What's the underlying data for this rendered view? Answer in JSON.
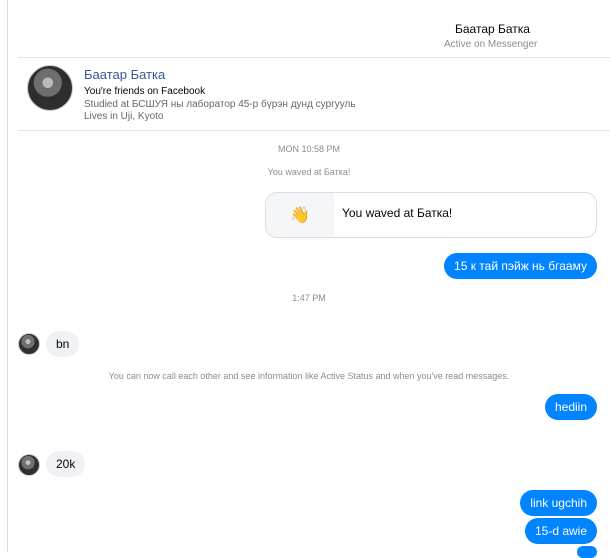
{
  "header": {
    "name": "Баатар Батка",
    "status": "Active on Messenger"
  },
  "profile": {
    "name": "Баатар Батка",
    "friends": "You're friends on Facebook",
    "studied": "Studied at БСШУЯ ны лаборатор 45-р бүрэн дунд сургууль",
    "lives": "Lives in Uji, Kyoto"
  },
  "messages": {
    "time_1": "MON 10:58 PM",
    "waved_note": "You waved at Батка!",
    "wave_card_text": "You waved at Батка!",
    "out_1": "15 к тай пэйж нь бгааму",
    "time_2": "1:47 PM",
    "in_1": "bn",
    "active_status_note": "You can now call each other and see information like Active Status and when you've read messages.",
    "out_2": "hediin",
    "in_2": "20k",
    "out_3": "link ugchih",
    "out_4": "15-d awie"
  },
  "icons": {
    "wave": "waving-hand-icon"
  },
  "colors": {
    "outgoing_bubble": "#0084ff",
    "incoming_bubble": "#f0f2f5",
    "profile_link": "#385898"
  }
}
